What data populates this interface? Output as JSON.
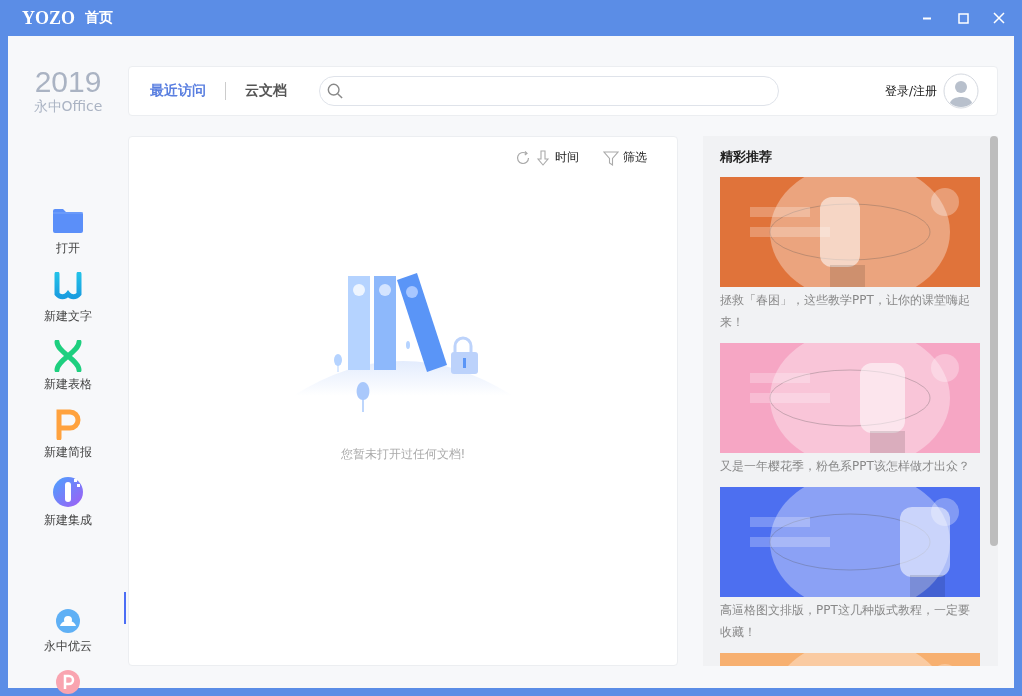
{
  "window": {
    "logo": "YOZO",
    "title": "首页"
  },
  "brand": {
    "year": "2019",
    "product": "永中Office"
  },
  "sidebar": {
    "items": [
      {
        "kind": "folder",
        "label": "打开"
      },
      {
        "kind": "writer",
        "label": "新建文字"
      },
      {
        "kind": "sheet",
        "label": "新建表格"
      },
      {
        "kind": "slides",
        "label": "新建简报"
      },
      {
        "kind": "suite",
        "label": "新建集成"
      }
    ],
    "bottom_items": [
      {
        "kind": "cloud",
        "label": "永中优云",
        "selected": true
      },
      {
        "kind": "pdf"
      }
    ]
  },
  "tabs": [
    {
      "label": "最近访问",
      "selected": true
    },
    {
      "label": "云文档",
      "selected": false
    }
  ],
  "account": {
    "label": "登录/注册"
  },
  "toolbar": {
    "sort_label": "时间",
    "filter_label": "筛选"
  },
  "empty_message": "您暂未打开过任何文档!",
  "recommendations": {
    "title": "精彩推荐",
    "items": [
      {
        "kind": "picture",
        "color": "#e0733a",
        "caption": "拯救「春困」，这些教学PPT，让你的课堂嗨起来！"
      },
      {
        "kind": "picture",
        "color": "#f6a6c4",
        "caption": "又是一年樱花季，粉色系PPT该怎样做才出众？"
      },
      {
        "kind": "picture",
        "color": "#4d6ff0",
        "caption": "高逼格图文排版，PPT这几种版式教程，一定要收藏！"
      },
      {
        "kind": "picture",
        "color": "#f7b070"
      }
    ]
  }
}
